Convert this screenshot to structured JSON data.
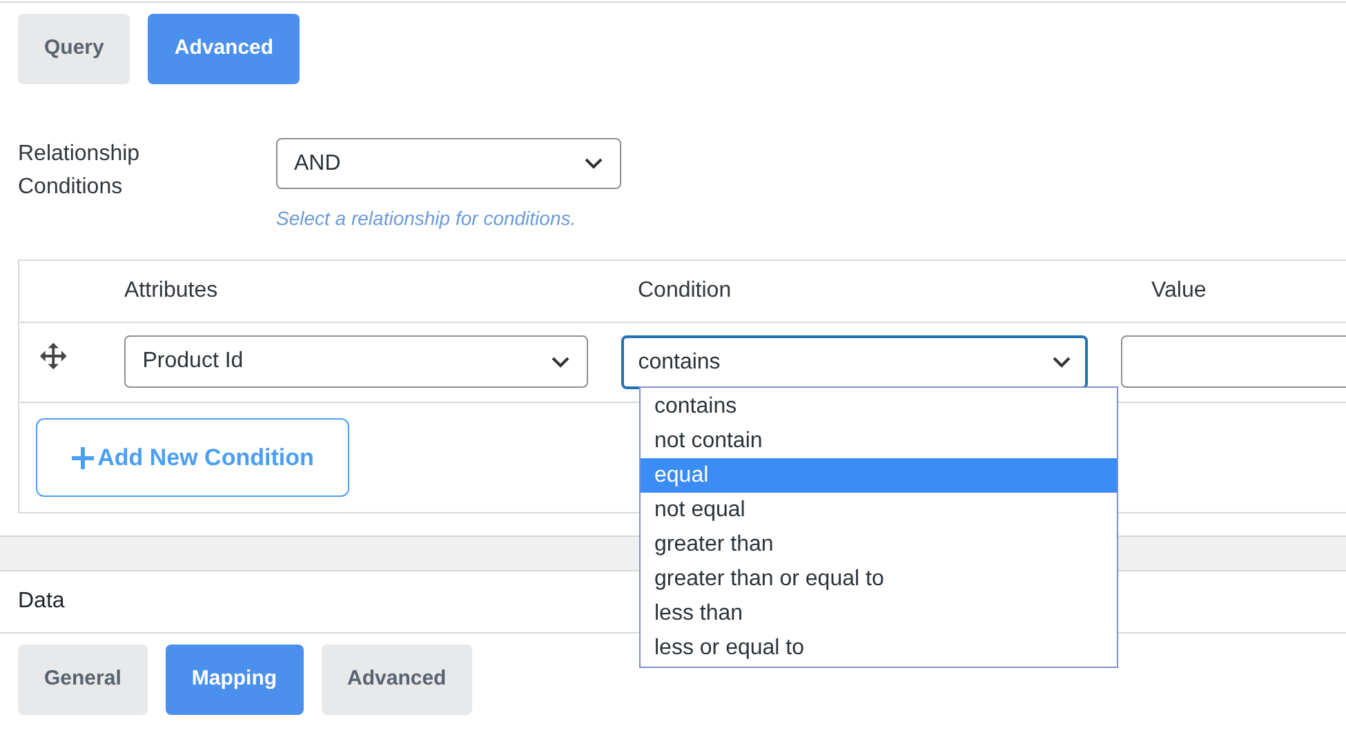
{
  "query_tabs": [
    {
      "label": "Query",
      "selected": false
    },
    {
      "label": "Advanced",
      "selected": true
    }
  ],
  "relationship": {
    "label": "Relationship Conditions",
    "value": "AND",
    "help": "Select a relationship for conditions."
  },
  "conditions_table": {
    "columns": [
      "Attributes",
      "Condition",
      "Value"
    ],
    "rows": [
      {
        "attribute": "Product Id",
        "condition": "contains",
        "value": ""
      }
    ],
    "add_button": "Add New Condition"
  },
  "condition_menu": {
    "options": [
      {
        "label": "contains",
        "selected": false
      },
      {
        "label": "not contain",
        "selected": false
      },
      {
        "label": "equal",
        "selected": true
      },
      {
        "label": "not equal",
        "selected": false
      },
      {
        "label": "greater than",
        "selected": false
      },
      {
        "label": "greater than or equal to",
        "selected": false
      },
      {
        "label": "less than",
        "selected": false
      },
      {
        "label": "less or equal to",
        "selected": false
      }
    ]
  },
  "data_section": {
    "title": "Data",
    "tabs": [
      {
        "label": "General",
        "selected": false
      },
      {
        "label": "Mapping",
        "selected": true
      },
      {
        "label": "Advanced",
        "selected": false
      }
    ]
  }
}
